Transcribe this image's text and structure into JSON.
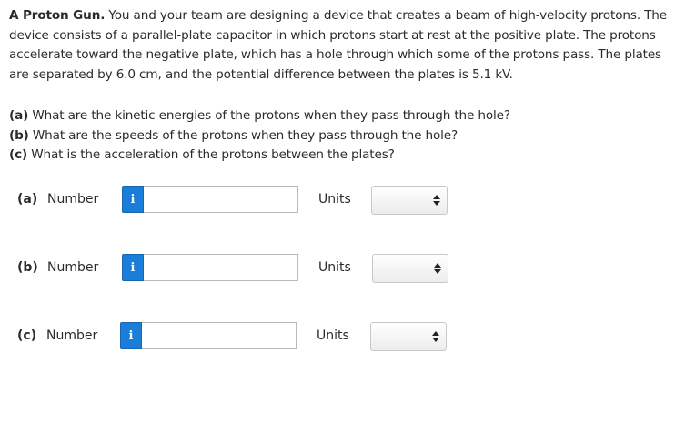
{
  "problem": {
    "title": "A Proton Gun.",
    "statement": " You and your team are designing a device that creates a beam of high-velocity protons. The device consists of a parallel-plate capacitor in which protons start at rest at the positive plate. The protons accelerate toward the negative plate, which has a hole through which some of the protons pass. The plates are separated by 6.0 cm, and the potential difference between the plates is 5.1 kV."
  },
  "questions": [
    {
      "label": "(a)",
      "text": " What are the kinetic energies of the protons when they pass through the hole?"
    },
    {
      "label": "(b)",
      "text": " What are the speeds of the protons when they pass through the hole?"
    },
    {
      "label": "(c)",
      "text": " What is the acceleration of the protons between the plates?"
    }
  ],
  "answers": [
    {
      "part": "(a)",
      "number_label": "Number",
      "info_icon": "i",
      "value": "",
      "units_label": "Units",
      "units_selected": ""
    },
    {
      "part": "(b)",
      "number_label": "Number",
      "info_icon": "i",
      "value": "",
      "units_label": "Units",
      "units_selected": ""
    },
    {
      "part": "(c)",
      "number_label": "Number",
      "info_icon": "i",
      "value": "",
      "units_label": "Units",
      "units_selected": ""
    }
  ],
  "colors": {
    "info_button": "#1a7dd7",
    "text": "#2b2b2b",
    "input_border": "#b9b9b9"
  },
  "icons": {
    "info": "info-icon",
    "select_arrows": "up-down-arrows-icon"
  }
}
